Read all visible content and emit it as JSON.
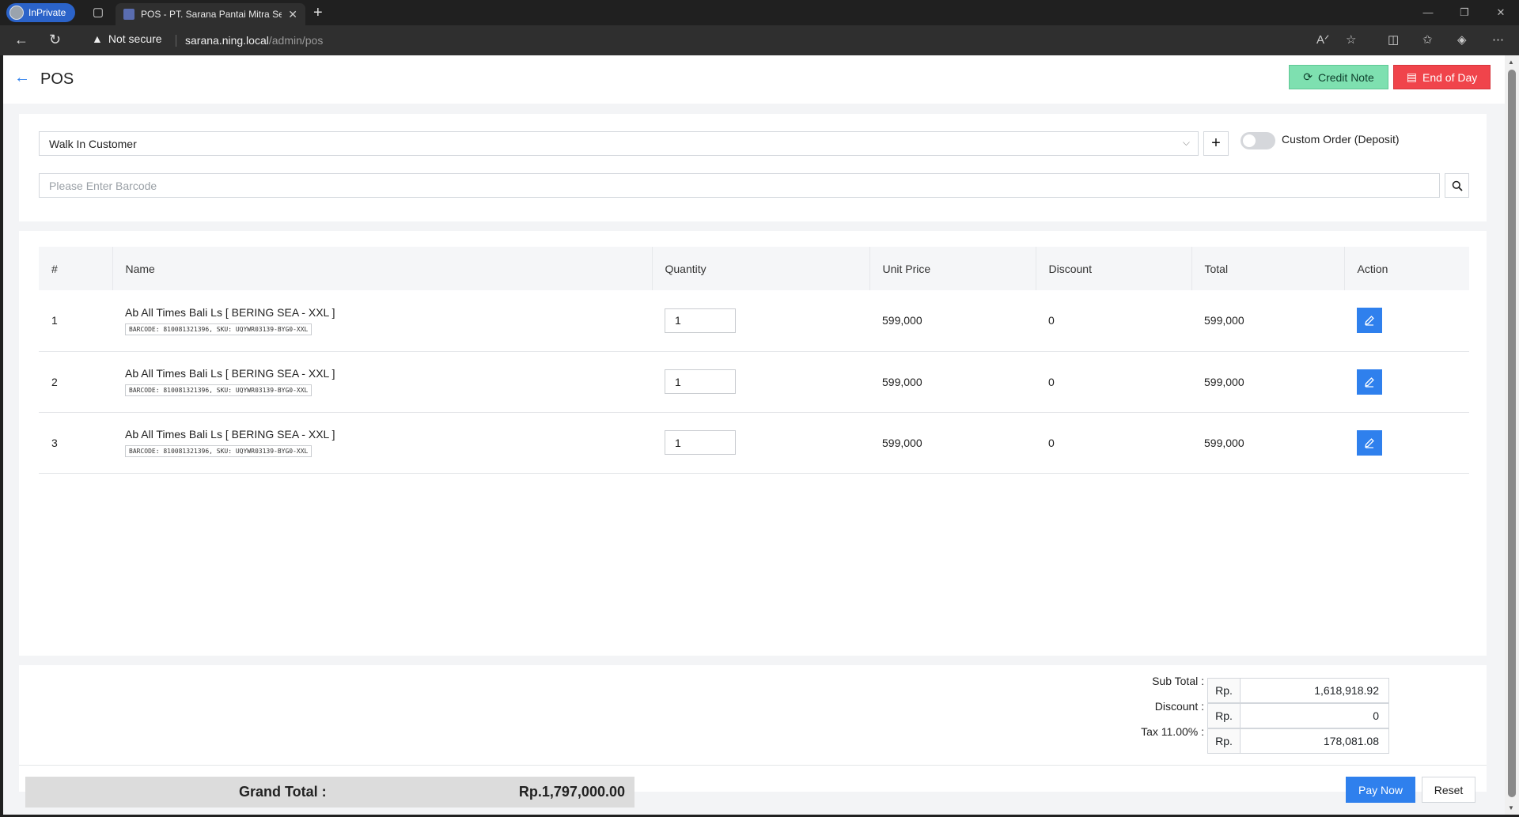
{
  "browser": {
    "inprivate_label": "InPrivate",
    "tab_title": "POS - PT. Sarana Pantai Mitra Se",
    "security_label": "Not secure",
    "url_host": "sarana.ning.local",
    "url_path": "/admin/pos"
  },
  "header": {
    "title": "POS",
    "credit_note_label": "Credit Note",
    "end_of_day_label": "End of Day"
  },
  "customer": {
    "selected": "Walk In Customer",
    "custom_order_label": "Custom Order (Deposit)",
    "custom_order_enabled": false
  },
  "barcode": {
    "placeholder": "Please Enter Barcode"
  },
  "table": {
    "headers": [
      "#",
      "Name",
      "Quantity",
      "Unit Price",
      "Discount",
      "Total",
      "Action"
    ],
    "rows": [
      {
        "no": "1",
        "name": "Ab All Times Bali Ls [ BERING SEA - XXL ]",
        "code": "BARCODE: 810081321396, SKU: UQYWR03139-BYG0-XXL",
        "qty": "1",
        "unit_price": "599,000",
        "discount": "0",
        "total": "599,000"
      },
      {
        "no": "2",
        "name": "Ab All Times Bali Ls [ BERING SEA - XXL ]",
        "code": "BARCODE: 810081321396, SKU: UQYWR03139-BYG0-XXL",
        "qty": "1",
        "unit_price": "599,000",
        "discount": "0",
        "total": "599,000"
      },
      {
        "no": "3",
        "name": "Ab All Times Bali Ls [ BERING SEA - XXL ]",
        "code": "BARCODE: 810081321396, SKU: UQYWR03139-BYG0-XXL",
        "qty": "1",
        "unit_price": "599,000",
        "discount": "0",
        "total": "599,000"
      }
    ]
  },
  "summary": {
    "currency": "Rp.",
    "subtotal_label": "Sub Total :",
    "subtotal": "1,618,918.92",
    "discount_label": "Discount :",
    "discount": "0",
    "tax_label": "Tax 11.00% :",
    "tax": "178,081.08"
  },
  "footer": {
    "grand_total_label": "Grand Total :",
    "grand_total": "Rp.1,797,000.00",
    "pay_label": "Pay Now",
    "reset_label": "Reset"
  },
  "colors": {
    "primary": "#2f80ed",
    "credit_note": "#7ee0b0",
    "end_of_day": "#f0444b"
  }
}
